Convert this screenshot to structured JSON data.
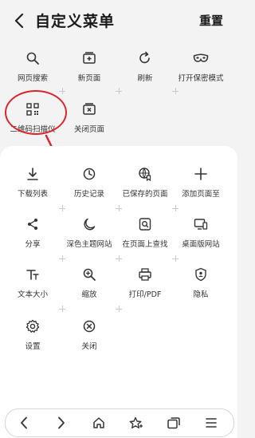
{
  "header": {
    "title": "自定义菜单",
    "reset_label": "重置"
  },
  "top_section": {
    "items": [
      {
        "label": "网页搜索",
        "icon": "search-icon"
      },
      {
        "label": "新页面",
        "icon": "new-tab-icon"
      },
      {
        "label": "刷新",
        "icon": "refresh-icon"
      },
      {
        "label": "打开保密模式",
        "icon": "mask-icon"
      },
      {
        "label": "二维码扫描仪",
        "icon": "qr-code-icon"
      },
      {
        "label": "关闭页面",
        "icon": "close-tab-icon"
      }
    ]
  },
  "panel": {
    "items": [
      {
        "label": "下载列表",
        "icon": "download-icon"
      },
      {
        "label": "历史记录",
        "icon": "clock-icon"
      },
      {
        "label": "已保存的页面",
        "icon": "saved-page-icon"
      },
      {
        "label": "添加页面至",
        "icon": "plus-icon"
      },
      {
        "label": "分享",
        "icon": "share-icon"
      },
      {
        "label": "深色主题网站",
        "icon": "moon-icon"
      },
      {
        "label": "在页面上查找",
        "icon": "find-in-page-icon"
      },
      {
        "label": "桌面版网站",
        "icon": "desktop-icon"
      },
      {
        "label": "文本大小",
        "icon": "text-size-icon"
      },
      {
        "label": "缩放",
        "icon": "zoom-in-icon"
      },
      {
        "label": "打印/PDF",
        "icon": "print-icon"
      },
      {
        "label": "隐私",
        "icon": "privacy-shield-icon"
      },
      {
        "label": "设置",
        "icon": "gear-icon"
      },
      {
        "label": "关闭",
        "icon": "close-circle-icon"
      }
    ]
  },
  "bottom_nav": {
    "icons": [
      "back-icon",
      "forward-icon",
      "home-icon",
      "bookmark-star-icon",
      "tabs-icon",
      "menu-icon"
    ]
  },
  "colors": {
    "annotation_red": "#d9262b",
    "panel_bg": "#ffffff",
    "page_bg": "#f3f3f3"
  }
}
